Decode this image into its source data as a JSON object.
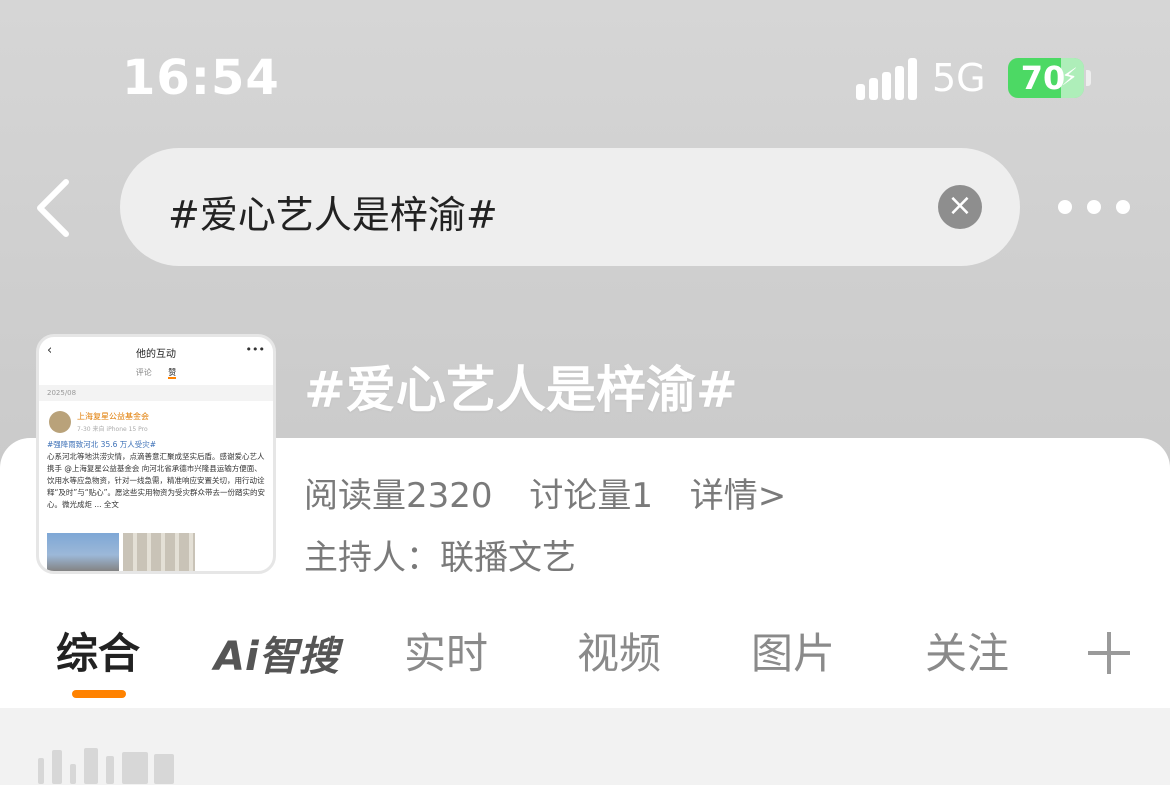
{
  "status_bar": {
    "time": "16:54",
    "network": "5G",
    "battery_level": "70",
    "battery_color": "#4cd964"
  },
  "search": {
    "query": "#爱心艺人是梓渝#",
    "back_icon": "chevron-left-icon",
    "clear_icon": "close-icon",
    "more_icon": "more-horizontal-icon"
  },
  "topic": {
    "title": "#爱心艺人是梓渝#",
    "read_count": "阅读量2320",
    "discussion_count": "讨论量1",
    "details_link": "详情>",
    "host": "主持人：联播文艺"
  },
  "thumbnail": {
    "header_title": "他的互动",
    "tab_comments": "评论",
    "tab_likes": "赞",
    "date": "2025/08",
    "org_name": "上海复星公益基金会",
    "meta": "7-30 来自 iPhone 15 Pro",
    "tag": "#强降雨致河北 35.6 万人受灾#",
    "body": "心系河北等地洪涝灾情，点滴善意汇聚成坚实后盾。感谢爱心艺人携手 @上海复星公益基金会 向河北省承德市兴隆县运输方便面、饮用水等应急物资，针对一线急需，精准响应安置关切，用行动诠释“及时”与“贴心”。愿这些实用物资为受灾群众带去一份踏实的安心。微光成炬 ... 全文"
  },
  "tabs": [
    {
      "label": "综合",
      "active": true
    },
    {
      "label": "Ai智搜",
      "active": false
    },
    {
      "label": "实时",
      "active": false
    },
    {
      "label": "视频",
      "active": false
    },
    {
      "label": "图片",
      "active": false
    },
    {
      "label": "关注",
      "active": false
    }
  ],
  "accent_color": "#ff8200"
}
